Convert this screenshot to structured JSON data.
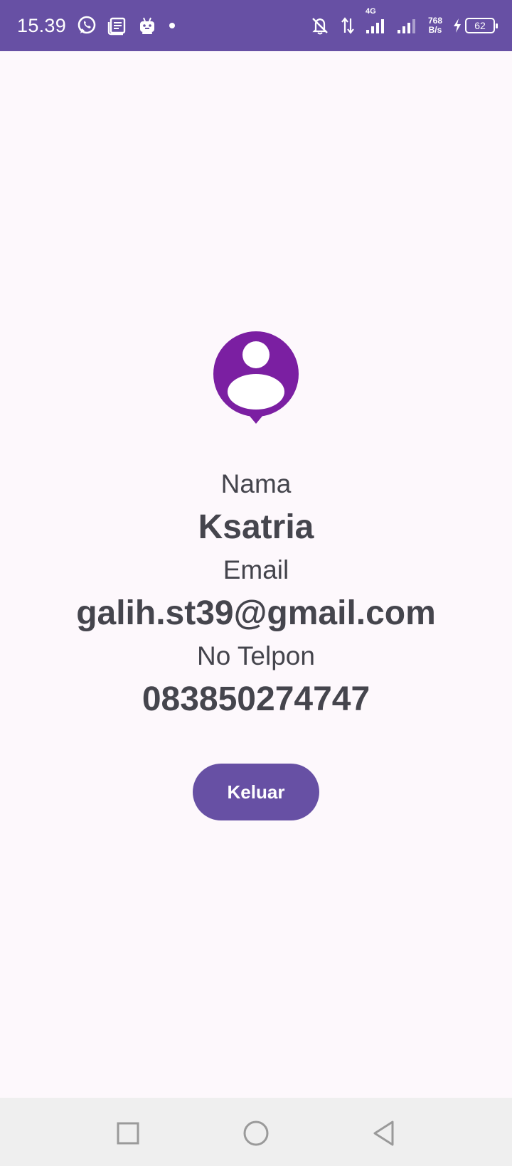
{
  "status_bar": {
    "time": "15.39",
    "network_type": "4G",
    "speed_value": "768",
    "speed_unit": "B/s",
    "battery": "62",
    "icons": [
      "whatsapp-icon",
      "news-icon",
      "bot-icon",
      "dot-icon",
      "mute-bell-icon",
      "data-arrows-icon",
      "signal-icon",
      "signal-icon-2",
      "charging-icon",
      "battery-icon"
    ]
  },
  "profile": {
    "name_label": "Nama",
    "name_value": "Ksatria",
    "email_label": "Email",
    "email_value": "galih.st39@gmail.com",
    "phone_label": "No Telpon",
    "phone_value": "083850274747"
  },
  "actions": {
    "logout_label": "Keluar"
  },
  "nav_bar": {
    "icons": [
      "recents-square-icon",
      "home-circle-icon",
      "back-triangle-icon"
    ]
  },
  "colors": {
    "primary": "#6750a4",
    "avatar": "#7b1fa2",
    "background": "#fdf8fc",
    "text": "#44444c",
    "nav_background": "#efefef"
  }
}
